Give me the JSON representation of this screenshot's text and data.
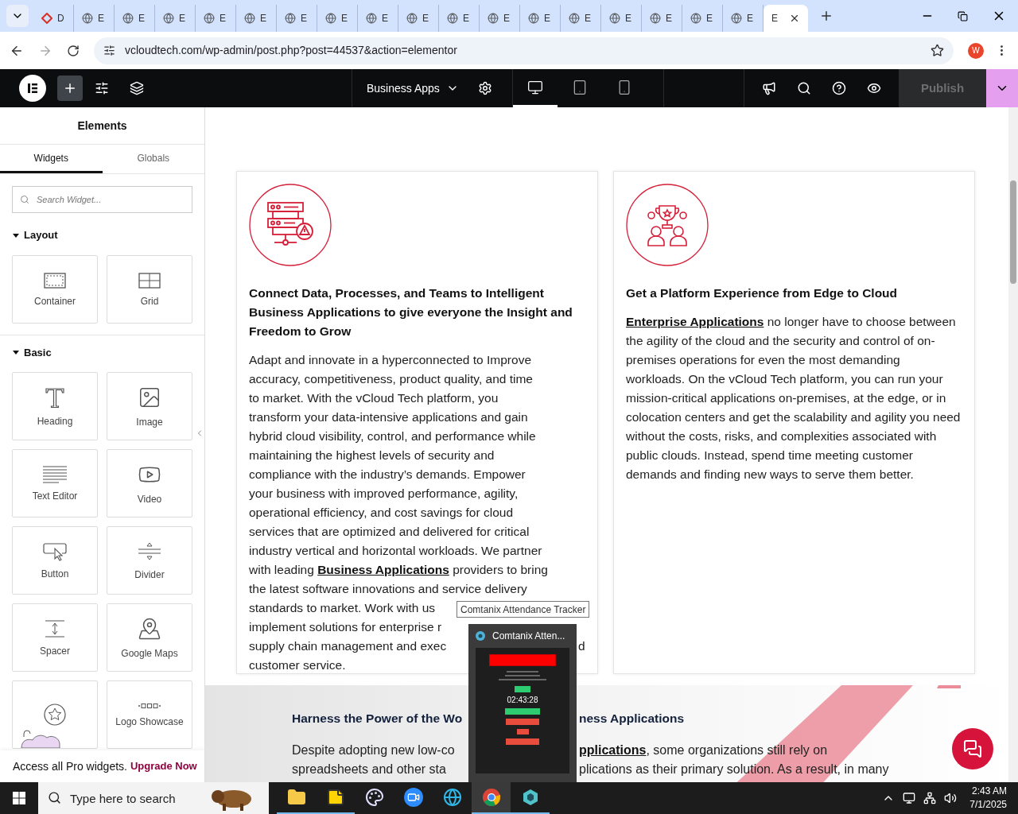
{
  "browser": {
    "tabs": [
      {
        "label": "D",
        "kind": "diamond",
        "selected": false
      },
      {
        "label": "E",
        "kind": "globe",
        "selected": false
      },
      {
        "label": "E",
        "kind": "globe",
        "selected": false
      },
      {
        "label": "E",
        "kind": "globe",
        "selected": false
      },
      {
        "label": "E",
        "kind": "globe",
        "selected": false
      },
      {
        "label": "E",
        "kind": "globe",
        "selected": false
      },
      {
        "label": "E",
        "kind": "globe",
        "selected": false
      },
      {
        "label": "E",
        "kind": "globe",
        "selected": false
      },
      {
        "label": "E",
        "kind": "globe",
        "selected": false
      },
      {
        "label": "E",
        "kind": "globe",
        "selected": false
      },
      {
        "label": "E",
        "kind": "globe",
        "selected": false
      },
      {
        "label": "E",
        "kind": "globe",
        "selected": false
      },
      {
        "label": "E",
        "kind": "globe",
        "selected": false
      },
      {
        "label": "E",
        "kind": "globe",
        "selected": false
      },
      {
        "label": "E",
        "kind": "globe",
        "selected": false
      },
      {
        "label": "E",
        "kind": "globe",
        "selected": false
      },
      {
        "label": "E",
        "kind": "globe",
        "selected": false
      },
      {
        "label": "E",
        "kind": "globe",
        "selected": false
      },
      {
        "label": "E",
        "kind": "none",
        "selected": true
      }
    ],
    "address": "vcloudtech.com/wp-admin/post.php?post=44537&action=elementor",
    "profile": "W"
  },
  "editor_bar": {
    "page_title": "Business Apps",
    "devices": [
      {
        "kind": "desktop",
        "selected": true
      },
      {
        "kind": "tablet",
        "selected": false
      },
      {
        "kind": "mobile",
        "selected": false
      }
    ],
    "publish": {
      "label": "Publish",
      "disabled": true
    }
  },
  "sidebar": {
    "title": "Elements",
    "tabs": [
      {
        "label": "Widgets",
        "selected": true
      },
      {
        "label": "Globals",
        "selected": false
      }
    ],
    "search": {
      "placeholder": "Search Widget..."
    },
    "sections": [
      {
        "title": "Layout",
        "expanded": true,
        "widgets": [
          {
            "label": "Container",
            "kind": "container"
          },
          {
            "label": "Grid",
            "kind": "grid"
          }
        ]
      },
      {
        "title": "Basic",
        "expanded": true,
        "widgets": [
          {
            "label": "Heading",
            "kind": "heading"
          },
          {
            "label": "Image",
            "kind": "image"
          },
          {
            "label": "Text Editor",
            "kind": "text"
          },
          {
            "label": "Video",
            "kind": "video"
          },
          {
            "label": "Button",
            "kind": "button"
          },
          {
            "label": "Divider",
            "kind": "divider"
          },
          {
            "label": "Spacer",
            "kind": "spacer"
          },
          {
            "label": "Google Maps",
            "kind": "map"
          },
          {
            "kind": "star"
          },
          {
            "label": "Logo Showcase",
            "kind": "logos"
          }
        ]
      }
    ],
    "promo": {
      "text": "Access all Pro widgets.",
      "link": "Upgrade Now"
    }
  },
  "cards": [
    {
      "title": "Connect Data, Processes, and Teams to Intelligent Business Applications to give everyone the Insight and Freedom to Grow",
      "lines": [
        {
          "segments": [
            {
              "text": "Adapt and innovate in a hyperconnected to Improve",
              "link": false
            }
          ]
        },
        {
          "segments": [
            {
              "text": "accuracy, competitiveness, product quality, and time",
              "link": false
            }
          ]
        },
        {
          "segments": [
            {
              "text": "to market. With the vCloud Tech platform, you",
              "link": false
            }
          ]
        },
        {
          "segments": [
            {
              "text": "transform your data-intensive applications and gain",
              "link": false
            }
          ]
        },
        {
          "segments": [
            {
              "text": "hybrid cloud visibility, control, and performance while",
              "link": false
            }
          ]
        },
        {
          "segments": [
            {
              "text": "maintaining the highest levels of security and",
              "link": false
            }
          ]
        },
        {
          "segments": [
            {
              "text": "compliance with the industry’s demands. Empower",
              "link": false
            }
          ]
        },
        {
          "segments": [
            {
              "text": "your business with improved performance, agility,",
              "link": false
            }
          ]
        },
        {
          "segments": [
            {
              "text": "operational efficiency, and cost savings for cloud",
              "link": false
            }
          ]
        },
        {
          "segments": [
            {
              "text": "services that are optimized and delivered for critical",
              "link": false
            }
          ]
        },
        {
          "segments": [
            {
              "text": "industry vertical and horizontal workloads. We partner",
              "link": false
            }
          ]
        },
        {
          "segments": [
            {
              "text": "with leading ",
              "link": false
            },
            {
              "text": "Business Applications",
              "link": true
            },
            {
              "text": " providers to bring",
              "link": false
            }
          ]
        },
        {
          "segments": [
            {
              "text": "the latest software innovations and service delivery",
              "link": false
            }
          ]
        },
        {
          "segments": [
            {
              "text": "standards to market. Work with us",
              "link": false
            }
          ]
        },
        {
          "segments": [
            {
              "text": "implement solutions for enterprise r",
              "link": false
            }
          ]
        },
        {
          "segments": [
            {
              "text": "supply chain management and exec",
              "link": false
            }
          ],
          "right": "d"
        },
        {
          "segments": [
            {
              "text": "customer service.",
              "link": false
            }
          ]
        }
      ]
    },
    {
      "title": "Get a Platform Experience from Edge to Cloud",
      "paragraph": [
        {
          "text": "Enterprise Applications",
          "link": true
        },
        {
          "text": " no longer have to choose between the agility of the cloud and the security and control of on-premises operations for even the most demanding workloads. On the vCloud Tech platform, you can run your mission-critical applications on-premises, at the edge, or in colocation centers and get the scalability and agility you need without the costs, risks, and complexities associated with public clouds. Instead, spend time meeting customer demands and finding new ways to serve them better.",
          "link": false
        }
      ]
    }
  ],
  "lower_section": {
    "heading_left": "Harness the Power of the Wo",
    "heading_right": "ness Applications",
    "lines": [
      {
        "left": [
          {
            "text": "Despite adopting new low-co",
            "link": false
          }
        ],
        "right": [
          {
            "text": "pplications",
            "link": true
          },
          {
            "text": ", some organizations still rely on",
            "link": false
          }
        ]
      },
      {
        "left": [
          {
            "text": "spreadsheets and other sta",
            "link": false
          }
        ],
        "right": [
          {
            "text": "plications as their primary solution. As a result, in many",
            "link": false
          }
        ]
      }
    ]
  },
  "tooltip": "Comtanix Attendance Tracker",
  "preview_window": {
    "title": "Comtanix Atten...",
    "clock": "02:43:28"
  },
  "taskbar": {
    "search_placeholder": "Type here to search",
    "apps": [
      {
        "kind": "folder",
        "running": true,
        "selected": false
      },
      {
        "kind": "notes",
        "running": true,
        "selected": false
      },
      {
        "kind": "paint",
        "running": false,
        "selected": false
      },
      {
        "kind": "zoom",
        "running": false,
        "selected": false
      },
      {
        "kind": "edge",
        "running": false,
        "selected": false
      },
      {
        "kind": "chrome",
        "running": true,
        "selected": true
      },
      {
        "kind": "tracker",
        "running": true,
        "selected": false
      }
    ],
    "time": "2:43 AM",
    "date": "7/1/2025"
  }
}
